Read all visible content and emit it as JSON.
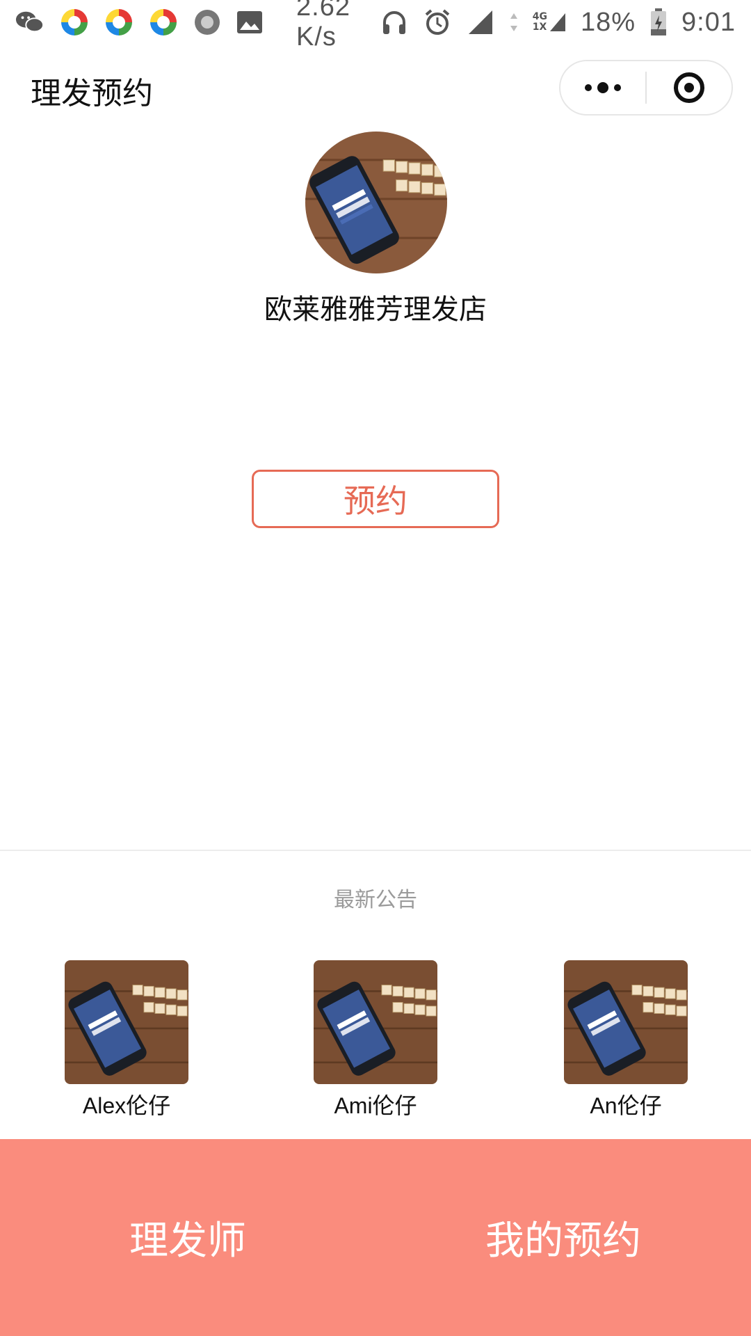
{
  "status_bar": {
    "network_speed": "2.62 K/s",
    "network_type_top": "4G",
    "network_type_bottom": "1X",
    "battery": "18%",
    "time": "9:01",
    "icons": [
      "wechat-icon",
      "app-icon",
      "app-icon",
      "app-icon",
      "circle-icon",
      "image-icon",
      "headphones-icon",
      "alarm-icon",
      "signal-icon",
      "data-arrows-icon",
      "signal-4g-icon",
      "battery-icon"
    ]
  },
  "header": {
    "title": "理发预约",
    "capsule": {
      "more_icon": "more-dots-icon",
      "close_icon": "target-icon"
    }
  },
  "shop": {
    "name": "欧莱雅雅芳理发店",
    "avatar_icon": "phone-photo-icon"
  },
  "reserve_button": {
    "label": "预约"
  },
  "notice": {
    "title": "最新公告"
  },
  "barbers": [
    {
      "name": "Alex伦仔"
    },
    {
      "name": "Ami伦仔"
    },
    {
      "name": "An伦仔"
    }
  ],
  "tab_bar": {
    "tabs": [
      {
        "label": "理发师"
      },
      {
        "label": "我的预约"
      }
    ]
  },
  "colors": {
    "accent": "#e66a55",
    "tab_bar_bg": "#fa8c7d",
    "notice_text": "#9a9a9a"
  }
}
